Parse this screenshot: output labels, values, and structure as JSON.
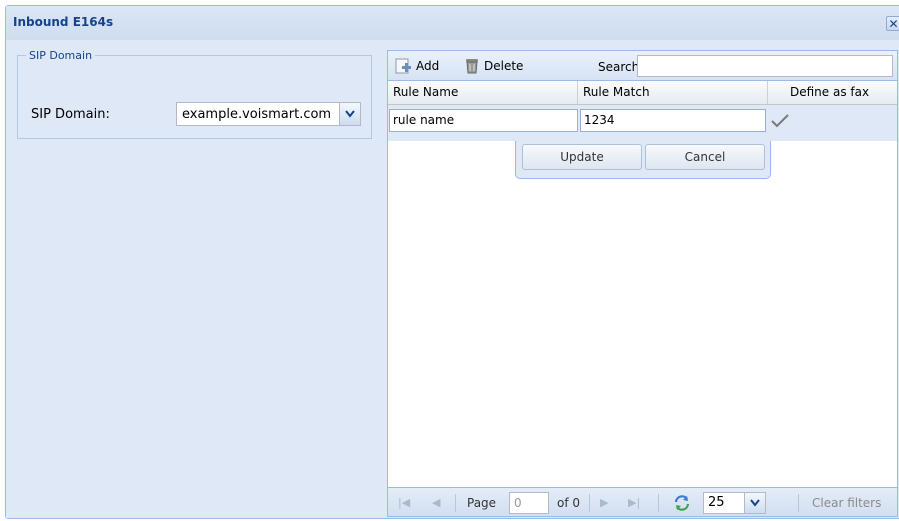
{
  "window": {
    "title": "Inbound E164s",
    "close_glyph": "✕"
  },
  "sip_panel": {
    "legend": "SIP Domain",
    "label": "SIP Domain:",
    "selected_value": "example.voismart.com"
  },
  "toolbar": {
    "add_label": "Add",
    "delete_label": "Delete",
    "search_label": "Search",
    "search_value": ""
  },
  "grid": {
    "columns": [
      "Rule Name",
      "Rule Match",
      "Define as fax"
    ],
    "editor": {
      "rule_name": "rule name",
      "rule_match": "1234",
      "define_as_fax": true,
      "update_label": "Update",
      "cancel_label": "Cancel"
    }
  },
  "paging": {
    "page_label": "Page",
    "page_value": "0",
    "of_label": "of 0",
    "page_size": "25",
    "clear_filters": "Clear filters"
  },
  "icons": {
    "add": "add-icon",
    "delete": "trash-icon",
    "first": "first-page-icon",
    "prev": "prev-page-icon",
    "next": "next-page-icon",
    "last": "last-page-icon",
    "refresh": "refresh-icon",
    "check": "check-icon"
  },
  "colors": {
    "window_bg": "#dfe8f6",
    "title_text": "#15428b",
    "border": "#99bbe8"
  }
}
